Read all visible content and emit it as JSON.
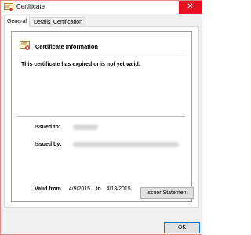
{
  "window": {
    "title": "Certificate",
    "close_glyph": "✕"
  },
  "tabs": [
    {
      "label": "General",
      "active": true
    },
    {
      "label": "Details",
      "active": false
    },
    {
      "label": "Certification Path",
      "active": false
    }
  ],
  "general": {
    "section_title": "Certificate Information",
    "warning": "This certificate has expired or is not yet valid.",
    "issued_to_label": "Issued to:",
    "issued_by_label": "Issued by:",
    "valid_from_label": "Valid from",
    "valid_from": "4/9/2015",
    "to_label": "to",
    "valid_to": "4/13/2015"
  },
  "buttons": {
    "issuer_statement": "Issuer Statement",
    "ok": "OK"
  },
  "icons": {
    "title_icon": "certificate-icon",
    "cert_icon": "certificate-warning-icon"
  },
  "colors": {
    "close_bg": "#e81123",
    "ok_border": "#0078d7",
    "window_border": "#e08a8a"
  }
}
